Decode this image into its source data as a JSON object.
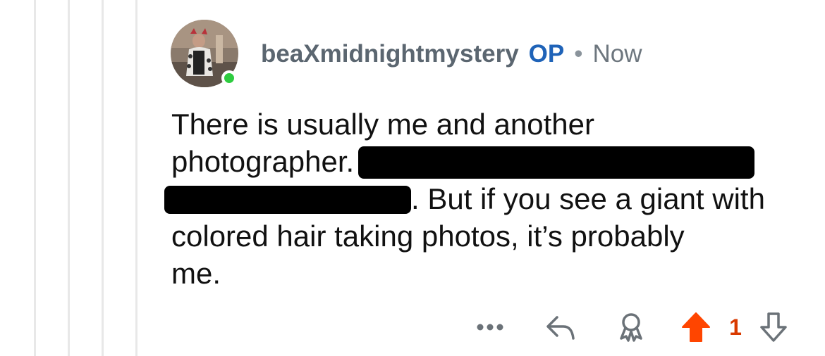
{
  "comment": {
    "username": "beaXmidnightmystery",
    "op_badge": "OP",
    "separator": "•",
    "timestamp": "Now",
    "body_lines": [
      "There is usually me and another",
      "photographer.",
      ". But if you see a giant with",
      "colored hair taking photos, it’s probably",
      "me."
    ],
    "vote_count": "1"
  },
  "icons": {
    "more": "more-dots-icon",
    "reply": "reply-arrow-icon",
    "award": "award-icon",
    "upvote": "upvote-arrow-icon",
    "downvote": "downvote-arrow-icon"
  },
  "colors": {
    "op": "#1f63b8",
    "upvote": "#ff4500",
    "vote_count": "#d93a00",
    "online": "#2ecc40",
    "thread_line": "#e8e8e8"
  }
}
